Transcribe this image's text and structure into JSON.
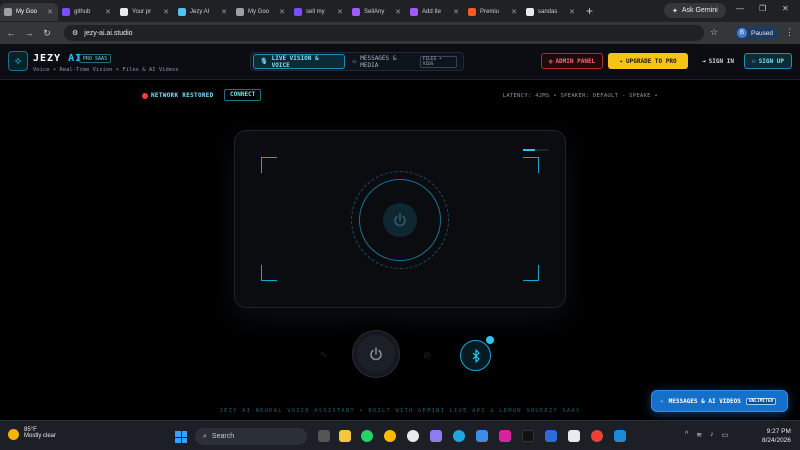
{
  "browser": {
    "tabs": [
      {
        "label": "My Goo",
        "color": "#9aa0a6",
        "active": true
      },
      {
        "label": "github",
        "color": "#7c4dff"
      },
      {
        "label": "Your pr",
        "color": "#e8eaed"
      },
      {
        "label": "Jezy AI",
        "color": "#4fc3f7"
      },
      {
        "label": "My Goo",
        "color": "#9aa0a6"
      },
      {
        "label": "sell my",
        "color": "#7c4dff"
      },
      {
        "label": "SellAny",
        "color": "#a259ff"
      },
      {
        "label": "Add Ite",
        "color": "#a259ff"
      },
      {
        "label": "Premiu",
        "color": "#ff5722"
      },
      {
        "label": "sandas",
        "color": "#e8eaed"
      }
    ],
    "new_tab": "+",
    "ask_gemini": "Ask Gemini",
    "url": "jezy-ai.ai.studio",
    "profile_initial": "B",
    "profile_status": "Paused"
  },
  "header": {
    "brand_main": "JEZY",
    "brand_ai": "AI",
    "badge": "PRO SAAS",
    "tagline": "Voice • Real-Time Vision • Files & AI Videos",
    "mode_live": "LIVE VISION & VOICE",
    "mode_messages": "MESSAGES & MEDIA",
    "mode_messages_badge": "FILES • VIDS",
    "admin": "ADMIN PANEL",
    "upgrade": "UPGRADE TO PRO",
    "sign_in": "SIGN IN",
    "sign_up": "SIGN UP"
  },
  "main": {
    "network_status": "NETWORK RESTORED",
    "connect": "CONNECT",
    "latency": "LATENCY: 42MS  •  SPEAKER: DEFAULT - SPEAKE  •",
    "audio_level": 0.45,
    "credit": "JEZY AI NEURAL VOICE ASSISTANT • BUILT WITH GEMINI LIVE API & LEMON SQUEEZY SAAS",
    "floating_button": "MESSAGES & AI VIDEOS",
    "floating_badge": "UNLIMITED"
  },
  "taskbar": {
    "temp": "85°F",
    "weather": "Mostly clear",
    "search": "Search",
    "time": "9:27 PM",
    "date": "8/24/2026"
  },
  "colors": {
    "accent": "#27c7f0",
    "danger": "#ff3b3b",
    "upgrade": "#f6c419",
    "float_button": "#1570c9"
  }
}
